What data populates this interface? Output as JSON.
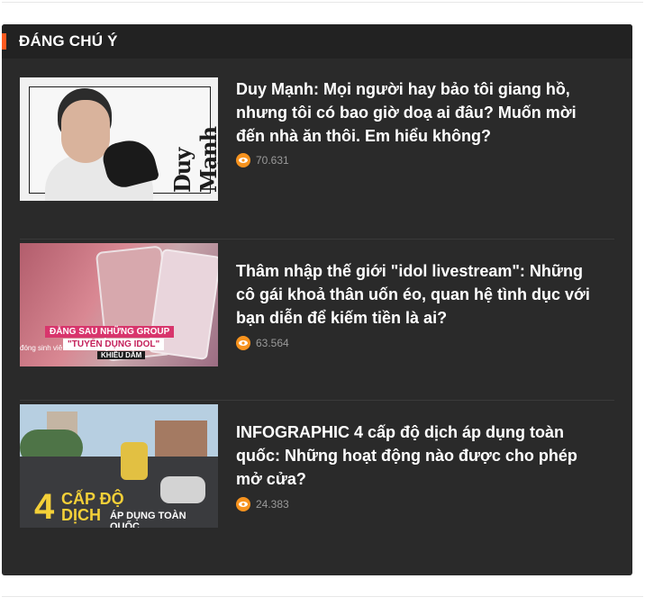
{
  "section": {
    "title": "ĐÁNG CHÚ Ý",
    "accent_color": "#ff5a1f"
  },
  "colors": {
    "panel_bg": "#2a2a2a",
    "title_text": "#ffffff",
    "views_text": "#9a9a9a",
    "eye_icon_bg": "#f7931e"
  },
  "articles": [
    {
      "title": "Duy Mạnh: Mọi người hay bảo tôi giang hồ, nhưng tôi có bao giờ doạ ai đâu? Muốn mời đến nhà ăn thôi. Em hiểu không?",
      "views": "70.631",
      "thumbnail": {
        "text": "Duy Mạnh"
      }
    },
    {
      "title": "Thâm nhập thế giới \"idol livestream\": Những cô gái khoả thân uốn éo, quan hệ tình dục với bạn diễn để kiếm tiền là ai?",
      "views": "63.564",
      "thumbnail": {
        "tag1": "ĐẰNG SAU NHỮNG GROUP",
        "tag2": "\"TUYỂN DỤNG IDOL\"",
        "tag3": "KHIÊU DÂM",
        "tag4": "đóng sinh viê"
      }
    },
    {
      "title": "INFOGRAPHIC 4 cấp độ dịch áp dụng toàn quốc: Những hoạt động nào được cho phép mở cửa?",
      "views": "24.383",
      "thumbnail": {
        "number": "4",
        "line1": "CẤP ĐỘ",
        "line2": "DỊCH",
        "sub": "ÁP DỤNG TOÀN QUỐC"
      }
    }
  ]
}
